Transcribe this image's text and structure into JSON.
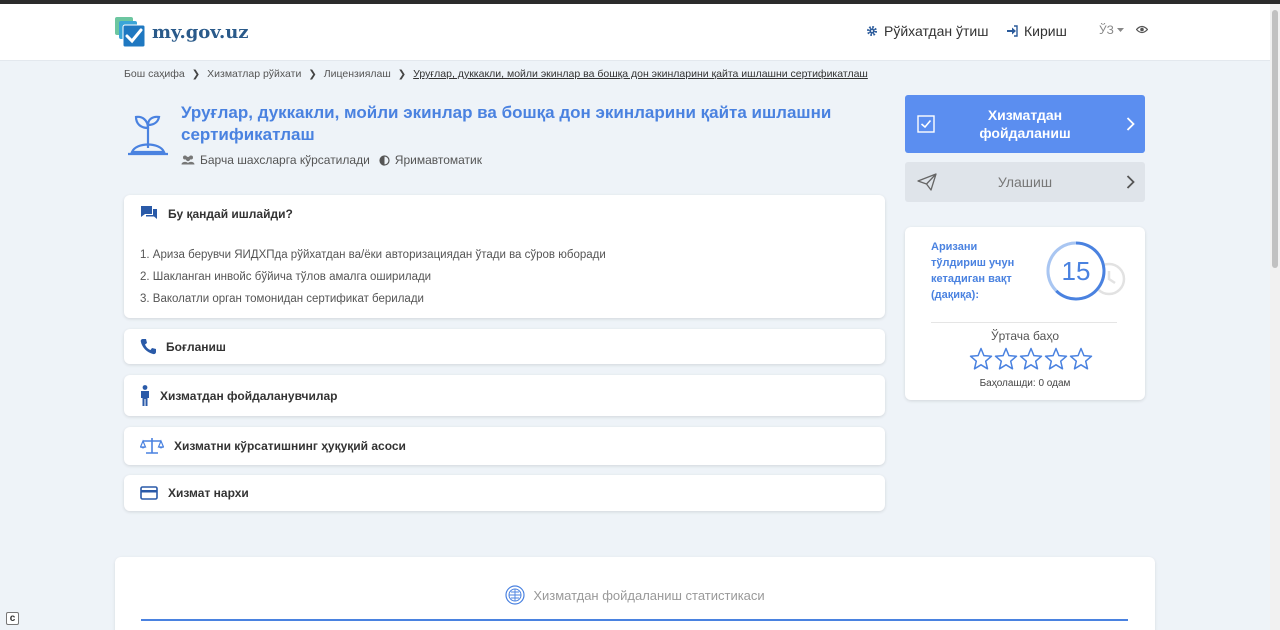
{
  "header": {
    "logo_text": "my.gov.uz",
    "register_label": "Рўйхатдан ўтиш",
    "login_label": "Кириш",
    "language": "ЎЗ"
  },
  "breadcrumb": {
    "items": [
      "Бош саҳифа",
      "Хизматлар рўйхати",
      "Лицензиялаш"
    ],
    "current": "Уруғлар, дуккакли, мойли экинлар ва бошқа дон экинларини қайта ишлашни сертификатлаш"
  },
  "service": {
    "title": "Уруғлар, дуккакли, мойли экинлар ва бошқа дон экинларини қайта ишлашни сертификатлаш",
    "audience": "Барча шахсларга кўрсатилади",
    "mode": "Яримавтоматик"
  },
  "how_it_works": {
    "title": "Бу қандай ишлайди?",
    "steps": [
      "1. Ариза берувчи ЯИДХПда рўйхатдан ва/ёки авторизациядан ўтади ва сўров юборади",
      "2. Шакланган инвойс бўйича тўлов амалга оширилади",
      "3. Ваколатли орган томонидан сертификат берилади"
    ]
  },
  "sections": {
    "contact": "Боғланиш",
    "users": "Хизматдан фойдаланувчилар",
    "legal_basis": "Хизматни кўрсатишнинг ҳуқуқий асоси",
    "price": "Хизмат нархи"
  },
  "actions": {
    "use_service": "Хизматдан фойдаланиш",
    "share": "Улашиш"
  },
  "info": {
    "time_label": "Аризани тўлдириш учун кетадиган вақт (дақиқа):",
    "time_value": "15",
    "rating_label": "Ўртача баҳо",
    "rating_value": 0,
    "rating_max": 5,
    "votes": "Баҳолашди: 0 одам"
  },
  "stats": {
    "title": "Хизматдан фойдаланиш статистикаси"
  },
  "colors": {
    "accent": "#4a82e0",
    "button": "#5b8ef0",
    "background": "#eef3f8"
  }
}
